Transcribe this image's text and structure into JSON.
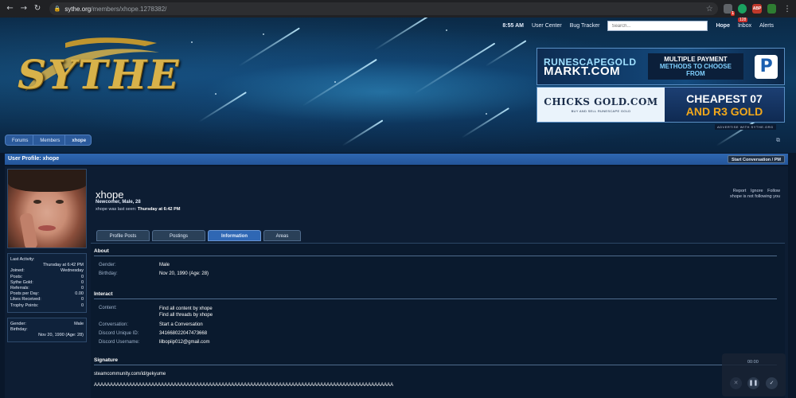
{
  "browser": {
    "url_host": "sythe.org",
    "url_path": "/members/xhope.1278382/",
    "ext_badge": "1",
    "abp_label": "ABP"
  },
  "site": {
    "logo": "SYTHE",
    "time": "8:55 AM",
    "nav": [
      "User Center",
      "Bug Tracker"
    ],
    "search_placeholder": "Search...",
    "user": "Hope",
    "inbox": "Inbox",
    "inbox_count": "128",
    "alerts": "Alerts"
  },
  "ads": {
    "ad1_brand_top": "RUNESCAPEGOLD",
    "ad1_brand_bottom": "MARKT.COM",
    "ad1_line1": "MULTIPLE PAYMENT",
    "ad1_line2": "METHODS TO CHOOSE FROM",
    "ad1_pp": "P",
    "ad2_name": "CHICKS GOLD.COM",
    "ad2_sub": "BUY AND SELL RUNESCAPE GOLD",
    "ad2_line1": "CHEAPEST 07",
    "ad2_line2": "AND R3 GOLD",
    "advertise": "ADVERTISE WITH SYTHE.ORG"
  },
  "breadcrumb": [
    "Forums",
    "Members",
    "xhope"
  ],
  "profile": {
    "title": "User Profile: xhope",
    "start_button": "Start Conversation / PM",
    "username": "xhope",
    "user_title": "Newcomer, Male, 28",
    "last_seen_prefix": "xhope was last seen:",
    "last_seen_value": "Thursday at 6:42 PM",
    "actions": [
      "Report",
      "Ignore",
      "Follow"
    ],
    "follow_note": "xhope is not following you"
  },
  "stats": {
    "last_activity_label": "Last Activity:",
    "last_activity_value": "Thursday at 6:42 PM",
    "joined_label": "Joined:",
    "joined_value": "Wednesday",
    "rows": [
      {
        "label": "Posts:",
        "value": "0"
      },
      {
        "label": "Sythe Gold:",
        "value": "0"
      },
      {
        "label": "Referrals:",
        "value": "0"
      },
      {
        "label": "Posts per Day:",
        "value": "0.00"
      },
      {
        "label": "Likes Received:",
        "value": "0"
      },
      {
        "label": "Trophy Points:",
        "value": "0"
      }
    ],
    "gender_label": "Gender:",
    "gender_value": "Male",
    "birthday_label": "Birthday:",
    "birthday_value": "Nov 20, 1990 (Age: 28)"
  },
  "tabs": [
    "Profile Posts",
    "Postings",
    "Information",
    "Areas"
  ],
  "about": {
    "heading": "About",
    "gender_label": "Gender:",
    "gender_value": "Male",
    "birthday_label": "Birthday:",
    "birthday_value": "Nov 20, 1990 (Age: 28)"
  },
  "interact": {
    "heading": "Interact",
    "content_label": "Content:",
    "content_link1": "Find all content by xhope",
    "content_link2": "Find all threads by xhope",
    "conversation_label": "Conversation:",
    "conversation_value": "Start a Conversation",
    "discord_id_label": "Discord Unique ID:",
    "discord_id_value": "341668022047473668",
    "discord_user_label": "Discord Username:",
    "discord_user_value": "lilbopiip012@gmail.com"
  },
  "signature": {
    "heading": "Signature",
    "line1": "steamcommunity.com/id/gekyume",
    "line2": "AAAAAAAAAAAAAAAAAAAAAAAAAAAAAAAAAAAAAAAAAAAAAAAAAAAAAAAAAAAAAAAAAAAAAAAAAAAAAAAAAAAAAAAAAAAAAA"
  },
  "media": {
    "time": "00:00"
  }
}
